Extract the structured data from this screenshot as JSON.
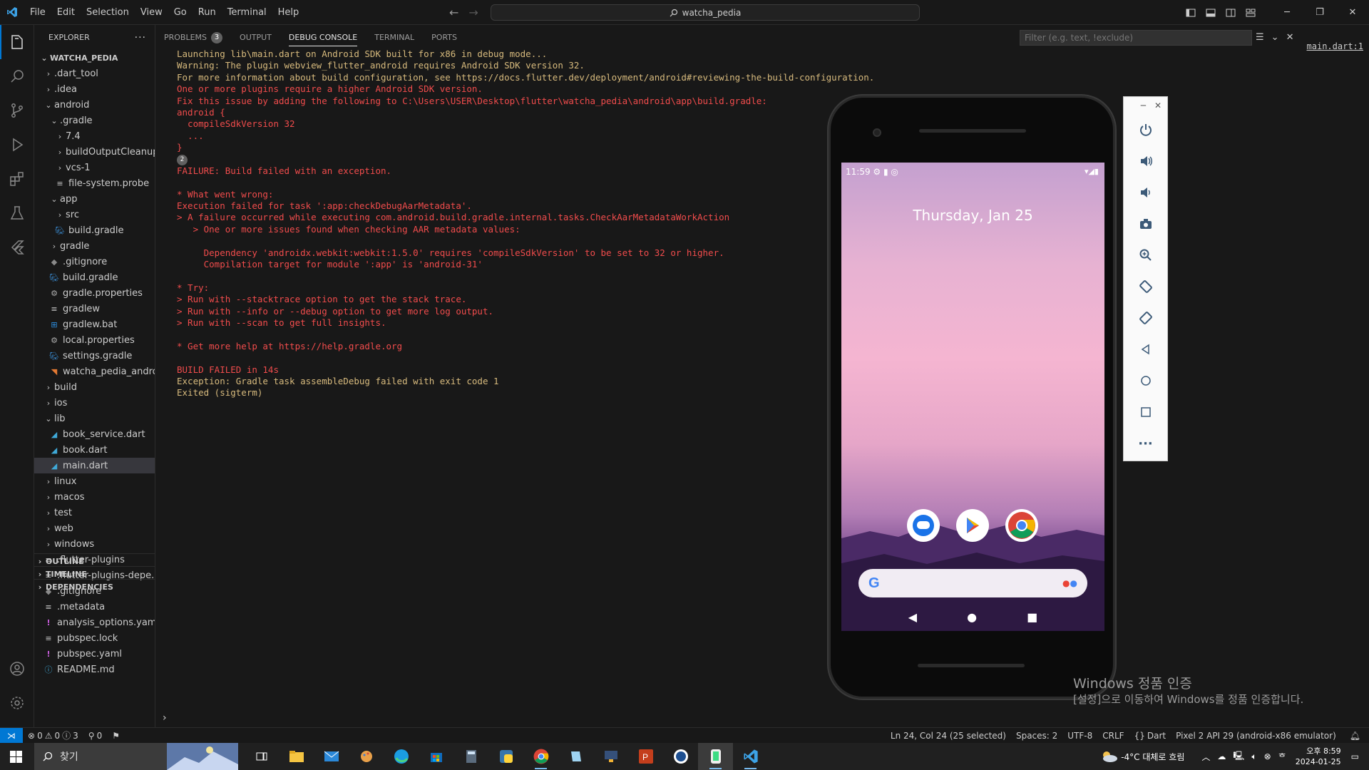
{
  "menu": [
    "File",
    "Edit",
    "Selection",
    "View",
    "Go",
    "Run",
    "Terminal",
    "Help"
  ],
  "command_center": "watcha_pedia",
  "explorer": {
    "title": "EXPLORER",
    "root": "WATCHA_PEDIA",
    "items": [
      {
        "label": ".dart_tool",
        "depth": 1,
        "type": "folder",
        "open": false
      },
      {
        "label": ".idea",
        "depth": 1,
        "type": "folder",
        "open": false
      },
      {
        "label": "android",
        "depth": 1,
        "type": "folder",
        "open": true
      },
      {
        "label": ".gradle",
        "depth": 2,
        "type": "folder",
        "open": true
      },
      {
        "label": "7.4",
        "depth": 3,
        "type": "folder",
        "open": false
      },
      {
        "label": "buildOutputCleanup",
        "depth": 3,
        "type": "folder",
        "open": false
      },
      {
        "label": "vcs-1",
        "depth": 3,
        "type": "folder",
        "open": false
      },
      {
        "label": "file-system.probe",
        "depth": 3,
        "type": "file",
        "icon": "lines"
      },
      {
        "label": "app",
        "depth": 2,
        "type": "folder",
        "open": true
      },
      {
        "label": "src",
        "depth": 3,
        "type": "folder",
        "open": false
      },
      {
        "label": "build.gradle",
        "depth": 3,
        "type": "file",
        "icon": "gradle"
      },
      {
        "label": "gradle",
        "depth": 2,
        "type": "folder",
        "open": false
      },
      {
        "label": ".gitignore",
        "depth": 2,
        "type": "file",
        "icon": "git"
      },
      {
        "label": "build.gradle",
        "depth": 2,
        "type": "file",
        "icon": "gradle"
      },
      {
        "label": "gradle.properties",
        "depth": 2,
        "type": "file",
        "icon": "gear"
      },
      {
        "label": "gradlew",
        "depth": 2,
        "type": "file",
        "icon": "lines"
      },
      {
        "label": "gradlew.bat",
        "depth": 2,
        "type": "file",
        "icon": "win"
      },
      {
        "label": "local.properties",
        "depth": 2,
        "type": "file",
        "icon": "gear"
      },
      {
        "label": "settings.gradle",
        "depth": 2,
        "type": "file",
        "icon": "gradle"
      },
      {
        "label": "watcha_pedia_andro...",
        "depth": 2,
        "type": "file",
        "icon": "rss"
      },
      {
        "label": "build",
        "depth": 1,
        "type": "folder",
        "open": false
      },
      {
        "label": "ios",
        "depth": 1,
        "type": "folder",
        "open": false
      },
      {
        "label": "lib",
        "depth": 1,
        "type": "folder",
        "open": true
      },
      {
        "label": "book_service.dart",
        "depth": 2,
        "type": "file",
        "icon": "dart"
      },
      {
        "label": "book.dart",
        "depth": 2,
        "type": "file",
        "icon": "dart"
      },
      {
        "label": "main.dart",
        "depth": 2,
        "type": "file",
        "icon": "dart",
        "selected": true
      },
      {
        "label": "linux",
        "depth": 1,
        "type": "folder",
        "open": false
      },
      {
        "label": "macos",
        "depth": 1,
        "type": "folder",
        "open": false
      },
      {
        "label": "test",
        "depth": 1,
        "type": "folder",
        "open": false
      },
      {
        "label": "web",
        "depth": 1,
        "type": "folder",
        "open": false
      },
      {
        "label": "windows",
        "depth": 1,
        "type": "folder",
        "open": false
      },
      {
        "label": ".flutter-plugins",
        "depth": 1,
        "type": "file",
        "icon": "lines"
      },
      {
        "label": ".flutter-plugins-depe...",
        "depth": 1,
        "type": "file",
        "icon": "lines"
      },
      {
        "label": ".gitignore",
        "depth": 1,
        "type": "file",
        "icon": "git"
      },
      {
        "label": ".metadata",
        "depth": 1,
        "type": "file",
        "icon": "lines"
      },
      {
        "label": "analysis_options.yaml",
        "depth": 1,
        "type": "file",
        "icon": "yaml"
      },
      {
        "label": "pubspec.lock",
        "depth": 1,
        "type": "file",
        "icon": "lines"
      },
      {
        "label": "pubspec.yaml",
        "depth": 1,
        "type": "file",
        "icon": "yaml"
      },
      {
        "label": "README.md",
        "depth": 1,
        "type": "file",
        "icon": "info"
      }
    ],
    "sections": [
      "OUTLINE",
      "TIMELINE",
      "DEPENDENCIES"
    ]
  },
  "panel": {
    "tabs": [
      {
        "label": "PROBLEMS",
        "badge": "3"
      },
      {
        "label": "OUTPUT"
      },
      {
        "label": "DEBUG CONSOLE",
        "active": true
      },
      {
        "label": "TERMINAL"
      },
      {
        "label": "PORTS"
      }
    ],
    "filter_placeholder": "Filter (e.g. text, !exclude)",
    "source_ref": "main.dart:1"
  },
  "console": [
    {
      "t": "Launching lib\\main.dart on Android SDK built for x86 in debug mode...",
      "c": "y"
    },
    {
      "t": "Warning: The plugin webview_flutter_android requires Android SDK version 32.",
      "c": "y"
    },
    {
      "t": "For more information about build configuration, see https://docs.flutter.dev/deployment/android#reviewing-the-build-configuration.",
      "c": "y"
    },
    {
      "t": "One or more plugins require a higher Android SDK version.",
      "c": "r"
    },
    {
      "t": "Fix this issue by adding the following to C:\\Users\\USER\\Desktop\\flutter\\watcha_pedia\\android\\app\\build.gradle:",
      "c": "r"
    },
    {
      "t": "android {",
      "c": "r"
    },
    {
      "t": "  compileSdkVersion 32",
      "c": "r"
    },
    {
      "t": "  ...",
      "c": "r"
    },
    {
      "t": "}",
      "c": "r"
    },
    {
      "t": "",
      "c": "r",
      "count": "2"
    },
    {
      "t": "FAILURE: Build failed with an exception.",
      "c": "r"
    },
    {
      "t": "",
      "c": "r"
    },
    {
      "t": "* What went wrong:",
      "c": "r"
    },
    {
      "t": "Execution failed for task ':app:checkDebugAarMetadata'.",
      "c": "r"
    },
    {
      "t": "> A failure occurred while executing com.android.build.gradle.internal.tasks.CheckAarMetadataWorkAction",
      "c": "r"
    },
    {
      "t": "   > One or more issues found when checking AAR metadata values:",
      "c": "r"
    },
    {
      "t": "",
      "c": "r"
    },
    {
      "t": "     Dependency 'androidx.webkit:webkit:1.5.0' requires 'compileSdkVersion' to be set to 32 or higher.",
      "c": "r"
    },
    {
      "t": "     Compilation target for module ':app' is 'android-31'",
      "c": "r"
    },
    {
      "t": "",
      "c": "r"
    },
    {
      "t": "* Try:",
      "c": "r"
    },
    {
      "t": "> Run with --stacktrace option to get the stack trace.",
      "c": "r"
    },
    {
      "t": "> Run with --info or --debug option to get more log output.",
      "c": "r"
    },
    {
      "t": "> Run with --scan to get full insights.",
      "c": "r"
    },
    {
      "t": "",
      "c": "r"
    },
    {
      "t": "* Get more help at https://help.gradle.org",
      "c": "r"
    },
    {
      "t": "",
      "c": "r"
    },
    {
      "t": "BUILD FAILED in 14s",
      "c": "r"
    },
    {
      "t": "Exception: Gradle task assembleDebug failed with exit code 1",
      "c": "y"
    },
    {
      "t": "Exited (sigterm)",
      "c": "y"
    }
  ],
  "emulator": {
    "time": "11:59",
    "date": "Thursday, Jan 25"
  },
  "watermark": {
    "line1": "Windows 정품 인증",
    "line2": "[설정]으로 이동하여 Windows를 정품 인증합니다."
  },
  "status": {
    "problems_errors": "0",
    "problems_warnings": "0",
    "problems_info": "3",
    "ports": "0",
    "cursor": "Ln 24, Col 24 (25 selected)",
    "spaces": "Spaces: 2",
    "encoding": "UTF-8",
    "eol": "CRLF",
    "language": "Dart",
    "device": "Pixel 2 API 29 (android-x86 emulator)"
  },
  "taskbar": {
    "search_label": "찾기",
    "weather": "-4°C  대체로 흐림",
    "time": "오후 8:59",
    "date": "2024-01-25"
  },
  "colors": {
    "accent": "#0078d4",
    "error": "#f14c4c",
    "warning": "#d7ba7d",
    "bg": "#181818"
  }
}
